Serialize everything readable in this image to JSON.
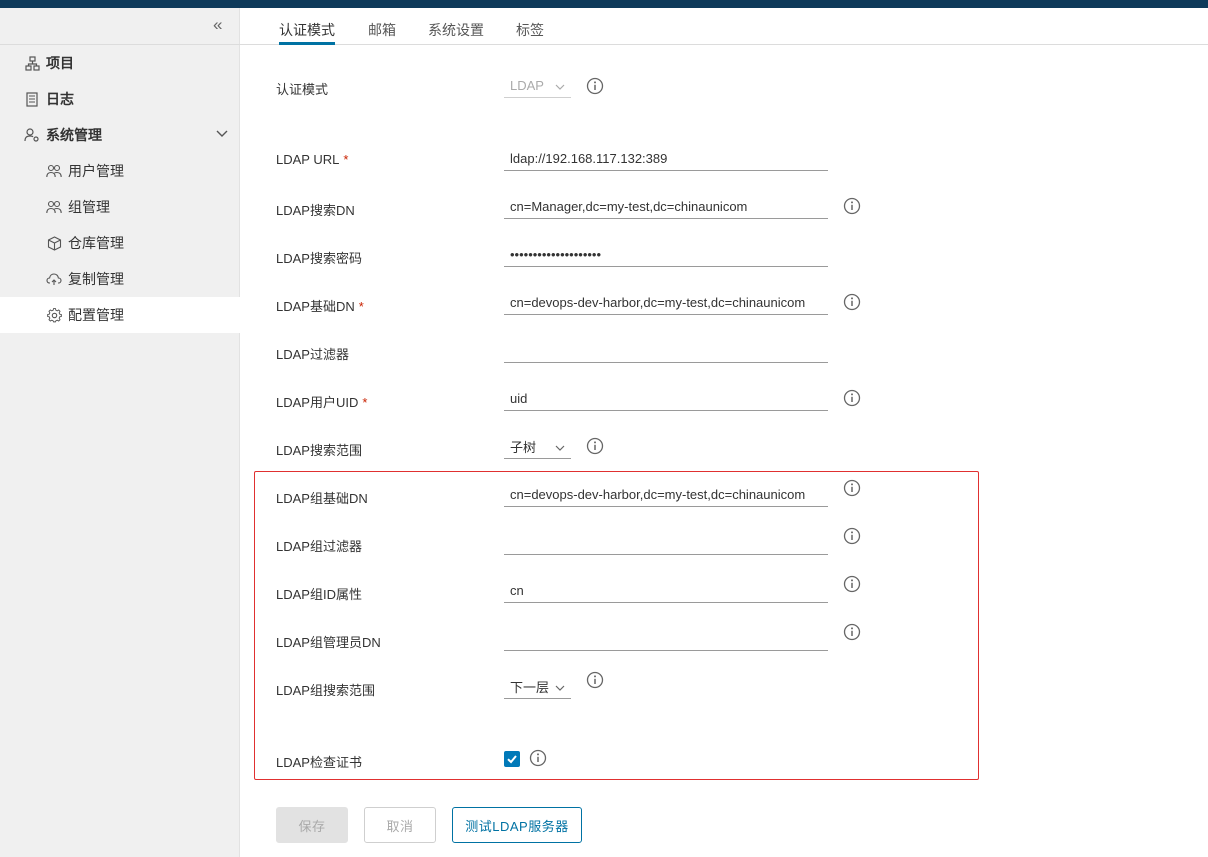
{
  "sidebar": {
    "items": [
      {
        "label": "项目",
        "icon": "project-icon"
      },
      {
        "label": "日志",
        "icon": "log-icon"
      },
      {
        "label": "系统管理",
        "icon": "admin-icon"
      }
    ],
    "subitems": [
      {
        "label": "用户管理",
        "icon": "users-icon"
      },
      {
        "label": "组管理",
        "icon": "groups-icon"
      },
      {
        "label": "仓库管理",
        "icon": "registry-icon"
      },
      {
        "label": "复制管理",
        "icon": "replication-icon"
      },
      {
        "label": "配置管理",
        "icon": "gear-icon"
      }
    ]
  },
  "tabs": [
    "认证模式",
    "邮箱",
    "系统设置",
    "标签"
  ],
  "form": {
    "auth_mode": {
      "label": "认证模式",
      "value": "LDAP"
    },
    "ldap_url": {
      "label": "LDAP URL",
      "value": "ldap://192.168.117.132:389"
    },
    "search_dn": {
      "label": "LDAP搜索DN",
      "value": "cn=Manager,dc=my-test,dc=chinaunicom"
    },
    "search_password": {
      "label": "LDAP搜索密码",
      "value": "••••••••••••••••••••"
    },
    "base_dn": {
      "label": "LDAP基础DN",
      "value": "cn=devops-dev-harbor,dc=my-test,dc=chinaunicom"
    },
    "filter": {
      "label": "LDAP过滤器",
      "value": ""
    },
    "uid": {
      "label": "LDAP用户UID",
      "value": "uid"
    },
    "scope": {
      "label": "LDAP搜索范围",
      "value": "子树"
    },
    "group_base_dn": {
      "label": "LDAP组基础DN",
      "value": "cn=devops-dev-harbor,dc=my-test,dc=chinaunicom"
    },
    "group_filter": {
      "label": "LDAP组过滤器",
      "value": ""
    },
    "group_id_attr": {
      "label": "LDAP组ID属性",
      "value": "cn"
    },
    "group_admin_dn": {
      "label": "LDAP组管理员DN",
      "value": ""
    },
    "group_scope": {
      "label": "LDAP组搜索范围",
      "value": "下一层"
    },
    "verify_cert": {
      "label": "LDAP检查证书",
      "checked": true
    },
    "required_mark": "*"
  },
  "buttons": {
    "save": "保存",
    "cancel": "取消",
    "test": "测试LDAP服务器"
  },
  "colors": {
    "accent": "#0072a3",
    "topbar": "#0e3a5a",
    "required": "#c92100",
    "highlight_box": "#e03030"
  }
}
